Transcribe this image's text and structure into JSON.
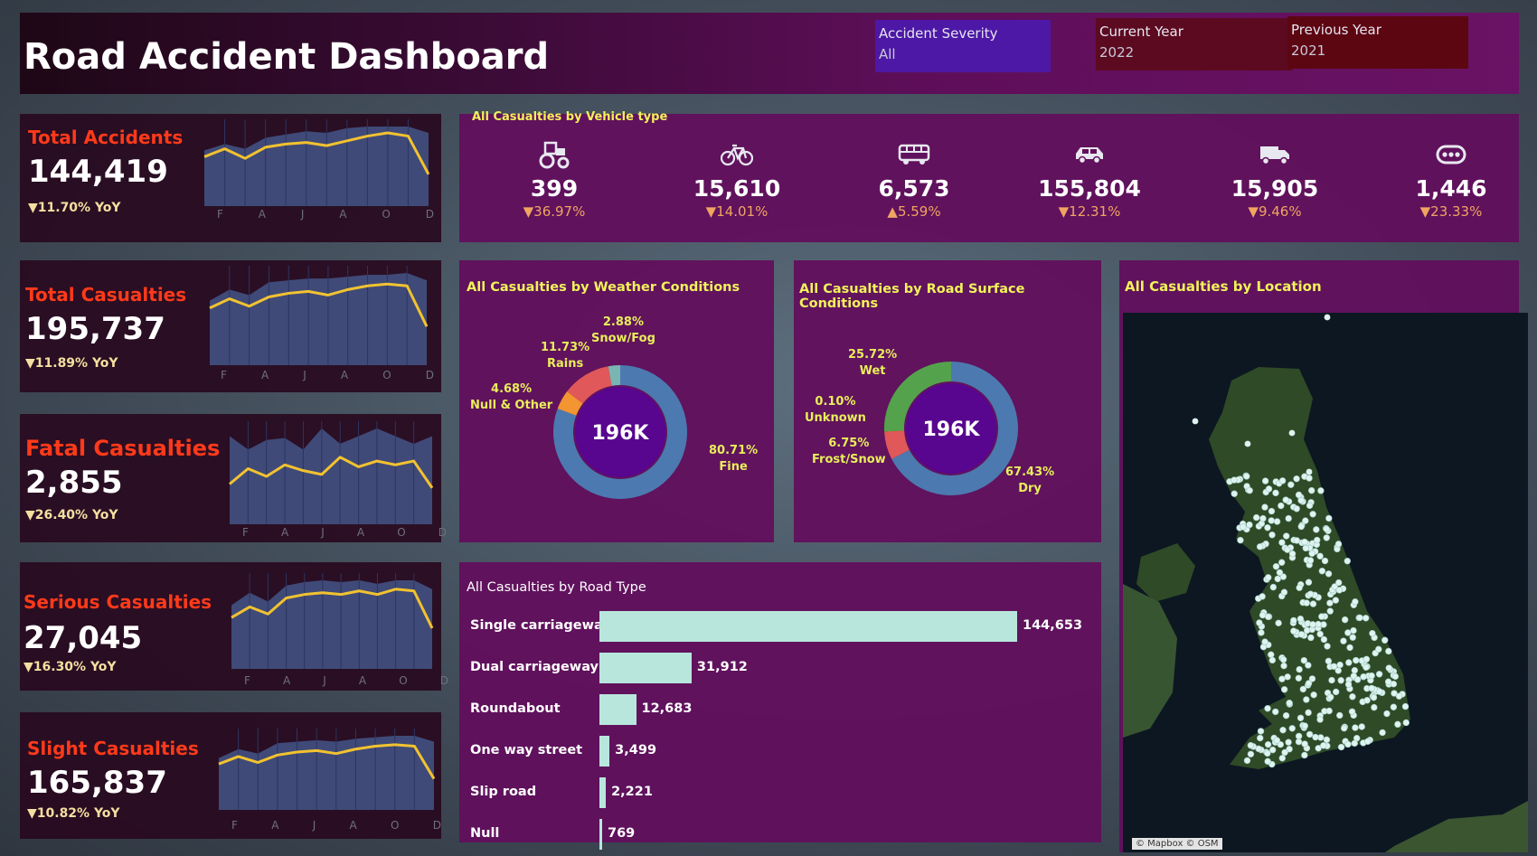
{
  "header": {
    "title": "Road Accident Dashboard",
    "filters": {
      "severity": {
        "label": "Accident Severity",
        "value": "All"
      },
      "current_year": {
        "label": "Current Year",
        "value": "2022"
      },
      "previous_year": {
        "label": "Previous Year",
        "value": "2021"
      }
    }
  },
  "colors": {
    "kpi_title": "#ff3a1a",
    "accent_line": "#f2c230",
    "spark_area": "#3f4a78",
    "yoy_down": "#f0a560",
    "chart_title": "#f1f25a",
    "bar": "#b8e6dc"
  },
  "months": [
    "F",
    "A",
    "J",
    "A",
    "O",
    "D"
  ],
  "kpis": [
    {
      "title": "Total Accidents",
      "value": "144,419",
      "yoy": "▼11.70% YoY",
      "trend": [
        0.62,
        0.72,
        0.6,
        0.74,
        0.78,
        0.8,
        0.76,
        0.82,
        0.88,
        0.92,
        0.88,
        0.4
      ],
      "area": [
        0.7,
        0.78,
        0.72,
        0.86,
        0.9,
        0.94,
        0.92,
        0.98,
        1.0,
        1.0,
        1.0,
        0.92
      ]
    },
    {
      "title": "Total Casualties",
      "value": "195,737",
      "yoy": "▼11.89% YoY",
      "trend": [
        0.62,
        0.72,
        0.64,
        0.74,
        0.78,
        0.8,
        0.76,
        0.82,
        0.86,
        0.88,
        0.86,
        0.42
      ],
      "area": [
        0.7,
        0.82,
        0.76,
        0.9,
        0.92,
        0.94,
        0.94,
        0.96,
        0.98,
        0.98,
        1.0,
        0.92
      ]
    },
    {
      "title": "Fatal Casualties",
      "value": "2,855",
      "yoy": "▼26.40% YoY",
      "trend": [
        0.42,
        0.58,
        0.5,
        0.62,
        0.56,
        0.52,
        0.7,
        0.6,
        0.66,
        0.62,
        0.66,
        0.38
      ],
      "area": [
        0.92,
        0.78,
        0.88,
        0.9,
        0.78,
        1.0,
        0.84,
        0.92,
        1.0,
        0.92,
        0.84,
        0.92
      ]
    },
    {
      "title": "Serious Casualties",
      "value": "27,045",
      "yoy": "▼16.30% YoY",
      "trend": [
        0.58,
        0.7,
        0.62,
        0.8,
        0.84,
        0.86,
        0.84,
        0.88,
        0.84,
        0.9,
        0.88,
        0.46
      ],
      "area": [
        0.72,
        0.86,
        0.76,
        0.94,
        0.98,
        1.0,
        0.98,
        1.0,
        0.96,
        1.0,
        1.0,
        0.9
      ]
    },
    {
      "title": "Slight Casualties",
      "value": "165,837",
      "yoy": "▼10.82% YoY",
      "trend": [
        0.62,
        0.72,
        0.64,
        0.74,
        0.78,
        0.8,
        0.76,
        0.82,
        0.86,
        0.88,
        0.86,
        0.42
      ],
      "area": [
        0.7,
        0.82,
        0.76,
        0.9,
        0.92,
        0.94,
        0.92,
        0.96,
        0.98,
        1.0,
        1.0,
        0.92
      ]
    }
  ],
  "vehicle_panel": {
    "title": "All Casualties by Vehicle type",
    "items": [
      {
        "icon": "tractor-icon",
        "value": "399",
        "yoy": "▼36.97%"
      },
      {
        "icon": "bicycle-icon",
        "value": "15,610",
        "yoy": "▼14.01%"
      },
      {
        "icon": "bus-icon",
        "value": "6,573",
        "yoy": "▲5.59%"
      },
      {
        "icon": "car-icon",
        "value": "155,804",
        "yoy": "▼12.31%"
      },
      {
        "icon": "truck-icon",
        "value": "15,905",
        "yoy": "▼9.46%"
      },
      {
        "icon": "other-vehicle-icon",
        "value": "1,446",
        "yoy": "▼23.33%"
      }
    ]
  },
  "weather": {
    "title": "All Casualties by Weather Conditions",
    "center": "196K",
    "slices": [
      {
        "name": "Fine",
        "pct": 80.71,
        "label": "80.71%",
        "color": "#4c79b0"
      },
      {
        "name": "Null & Other",
        "pct": 4.68,
        "label": "4.68%",
        "color": "#f39531"
      },
      {
        "name": "Rains",
        "pct": 11.73,
        "label": "11.73%",
        "color": "#e0585a"
      },
      {
        "name": "Snow/Fog",
        "pct": 2.88,
        "label": "2.88%",
        "color": "#79b6b3"
      }
    ]
  },
  "surface": {
    "title": "All Casualties by Road Surface Conditions",
    "center": "196K",
    "slices": [
      {
        "name": "Dry",
        "pct": 67.43,
        "label": "67.43%",
        "color": "#4c79b0"
      },
      {
        "name": "Frost/Snow",
        "pct": 6.75,
        "label": "6.75%",
        "color": "#e0585a"
      },
      {
        "name": "Unknown",
        "pct": 0.1,
        "label": "0.10%",
        "color": "#f39531"
      },
      {
        "name": "Wet",
        "pct": 25.72,
        "label": "25.72%",
        "color": "#55a24c"
      }
    ]
  },
  "roadtype": {
    "title": "All Casualties by Road Type",
    "rows": [
      {
        "name": "Single carriageway",
        "value": 144653,
        "label": "144,653"
      },
      {
        "name": "Dual carriageway",
        "value": 31912,
        "label": "31,912"
      },
      {
        "name": "Roundabout",
        "value": 12683,
        "label": "12,683"
      },
      {
        "name": "One way street",
        "value": 3499,
        "label": "3,499"
      },
      {
        "name": "Slip road",
        "value": 2221,
        "label": "2,221"
      },
      {
        "name": "Null",
        "value": 769,
        "label": "769"
      }
    ]
  },
  "location": {
    "title": "All Casualties by Location",
    "attribution": "© Mapbox © OSM"
  }
}
